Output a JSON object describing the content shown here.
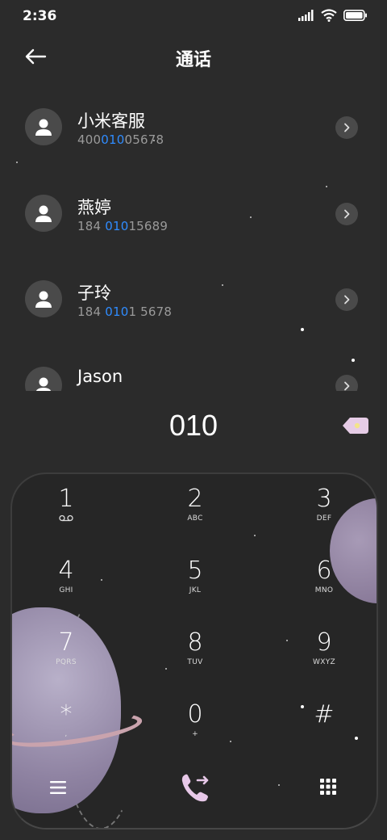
{
  "status_bar": {
    "time": "2:36",
    "icons": [
      "signal-icon",
      "wifi-icon",
      "battery-icon"
    ]
  },
  "header": {
    "title": "通话",
    "back_icon": "back-arrow-icon"
  },
  "contacts": [
    {
      "name": "小米客服",
      "number_pre": "400",
      "number_match": "010",
      "number_post": "05678"
    },
    {
      "name": "燕婷",
      "number_pre": "184 ",
      "number_match": "010",
      "number_post": "15689"
    },
    {
      "name": "子玲",
      "number_pre": "184 ",
      "number_match": "010",
      "number_post": "1 5678"
    },
    {
      "name": "Jason",
      "number_pre": "",
      "number_match": "",
      "number_post": ""
    }
  ],
  "dial": {
    "input": "010",
    "backspace_icon": "backspace-icon"
  },
  "keypad": {
    "keys": [
      {
        "digit": "1",
        "sub": ""
      },
      {
        "digit": "2",
        "sub": "ABC"
      },
      {
        "digit": "3",
        "sub": "DEF"
      },
      {
        "digit": "4",
        "sub": "GHI"
      },
      {
        "digit": "5",
        "sub": "JKL"
      },
      {
        "digit": "6",
        "sub": "MNO"
      },
      {
        "digit": "7",
        "sub": "PQRS"
      },
      {
        "digit": "8",
        "sub": "TUV"
      },
      {
        "digit": "9",
        "sub": "WXYZ"
      },
      {
        "digit": "*",
        "sub": ","
      },
      {
        "digit": "0",
        "sub": "+"
      },
      {
        "digit": "#",
        "sub": ""
      }
    ],
    "bottom_icons": [
      "menu-icon",
      "call-icon",
      "keypad-icon"
    ]
  },
  "colors": {
    "background": "#2b2b2b",
    "highlight": "#2f8cff",
    "call_button": "#e7c8e8",
    "backspace": "#e6cce6"
  }
}
